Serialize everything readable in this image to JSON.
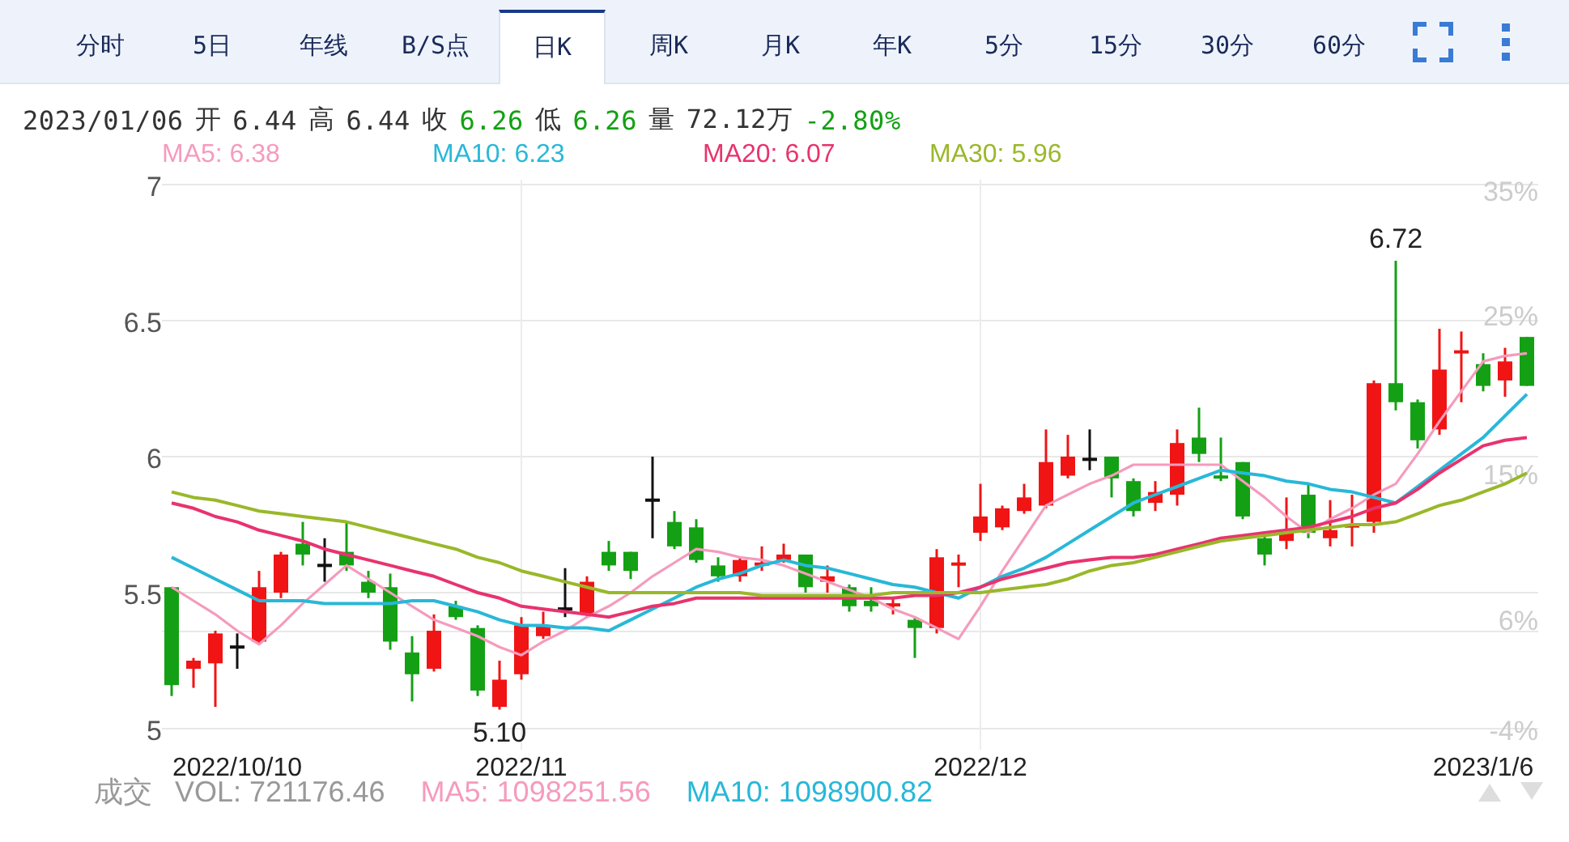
{
  "tabs": [
    {
      "label": "分时",
      "selected": false
    },
    {
      "label": "5日",
      "selected": false
    },
    {
      "label": "年线",
      "selected": false
    },
    {
      "label": "B/S点",
      "selected": false
    },
    {
      "label": "日K",
      "selected": true
    },
    {
      "label": "周K",
      "selected": false
    },
    {
      "label": "月K",
      "selected": false
    },
    {
      "label": "年K",
      "selected": false
    },
    {
      "label": "5分",
      "selected": false
    },
    {
      "label": "15分",
      "selected": false
    },
    {
      "label": "30分",
      "selected": false
    },
    {
      "label": "60分",
      "selected": false
    }
  ],
  "quote": {
    "date": "2023/01/06",
    "fields": [
      {
        "label": "开",
        "value": "6.44",
        "color": "#333333"
      },
      {
        "label": "高",
        "value": "6.44",
        "color": "#333333"
      },
      {
        "label": "收",
        "value": "6.26",
        "color": "#14a014"
      },
      {
        "label": "低",
        "value": "6.26",
        "color": "#14a014"
      },
      {
        "label": "量",
        "value": "72.12万",
        "color": "#333333"
      }
    ],
    "change": {
      "text": "-2.80%",
      "color": "#14a014"
    }
  },
  "chart": {
    "percent_labels": [
      "35%",
      "25%",
      "15%",
      "6%",
      "-4%"
    ],
    "chart_data": {
      "type": "candlestick",
      "ylim": [
        5,
        7
      ],
      "yticks": [
        5,
        5.5,
        6,
        6.5,
        7
      ],
      "grid": true,
      "categories": [
        null,
        null,
        null,
        "2022/10/10",
        null,
        null,
        null,
        null,
        null,
        null,
        null,
        null,
        null,
        null,
        null,
        null,
        "2022/11",
        null,
        null,
        null,
        null,
        null,
        null,
        null,
        null,
        null,
        null,
        null,
        null,
        null,
        null,
        null,
        null,
        null,
        null,
        null,
        null,
        "2022/12",
        null,
        null,
        null,
        null,
        null,
        null,
        null,
        null,
        null,
        null,
        null,
        null,
        null,
        null,
        null,
        null,
        null,
        null,
        null,
        null,
        null,
        null,
        "2023/1/6",
        null,
        null
      ],
      "ohlc": [
        [
          5.52,
          5.52,
          5.12,
          5.16
        ],
        [
          5.22,
          5.26,
          5.15,
          5.25
        ],
        [
          5.24,
          5.36,
          5.08,
          5.35
        ],
        [
          5.3,
          5.35,
          5.22,
          5.3
        ],
        [
          5.32,
          5.58,
          5.31,
          5.52
        ],
        [
          5.5,
          5.65,
          5.48,
          5.64
        ],
        [
          5.68,
          5.76,
          5.6,
          5.64
        ],
        [
          5.6,
          5.7,
          5.54,
          5.6
        ],
        [
          5.65,
          5.76,
          5.58,
          5.6
        ],
        [
          5.54,
          5.58,
          5.48,
          5.5
        ],
        [
          5.52,
          5.57,
          5.29,
          5.32
        ],
        [
          5.28,
          5.34,
          5.1,
          5.2
        ],
        [
          5.22,
          5.42,
          5.21,
          5.36
        ],
        [
          5.45,
          5.47,
          5.4,
          5.41
        ],
        [
          5.37,
          5.38,
          5.12,
          5.14
        ],
        [
          5.08,
          5.25,
          5.07,
          5.18
        ],
        [
          5.2,
          5.41,
          5.18,
          5.38
        ],
        [
          5.34,
          5.43,
          5.33,
          5.38
        ],
        [
          5.44,
          5.59,
          5.41,
          5.44
        ],
        [
          5.42,
          5.56,
          5.41,
          5.54
        ],
        [
          5.65,
          5.69,
          5.58,
          5.6
        ],
        [
          5.65,
          5.65,
          5.55,
          5.58
        ],
        [
          5.84,
          6.0,
          5.7,
          5.84
        ],
        [
          5.76,
          5.8,
          5.66,
          5.67
        ],
        [
          5.74,
          5.77,
          5.61,
          5.62
        ],
        [
          5.6,
          5.63,
          5.54,
          5.56
        ],
        [
          5.56,
          5.63,
          5.54,
          5.62
        ],
        [
          5.6,
          5.67,
          5.58,
          5.61
        ],
        [
          5.62,
          5.68,
          5.61,
          5.64
        ],
        [
          5.64,
          5.64,
          5.5,
          5.52
        ],
        [
          5.54,
          5.6,
          5.5,
          5.56
        ],
        [
          5.52,
          5.53,
          5.43,
          5.45
        ],
        [
          5.47,
          5.52,
          5.43,
          5.45
        ],
        [
          5.45,
          5.48,
          5.42,
          5.46
        ],
        [
          5.4,
          5.41,
          5.26,
          5.37
        ],
        [
          5.37,
          5.66,
          5.35,
          5.63
        ],
        [
          5.6,
          5.64,
          5.52,
          5.61
        ],
        [
          5.72,
          5.9,
          5.69,
          5.78
        ],
        [
          5.74,
          5.82,
          5.73,
          5.81
        ],
        [
          5.8,
          5.9,
          5.79,
          5.85
        ],
        [
          5.82,
          6.1,
          5.81,
          5.98
        ],
        [
          5.93,
          6.08,
          5.92,
          6.0
        ],
        [
          5.99,
          6.1,
          5.95,
          5.99
        ],
        [
          6.0,
          6.0,
          5.85,
          5.92
        ],
        [
          5.91,
          5.92,
          5.78,
          5.8
        ],
        [
          5.83,
          5.91,
          5.8,
          5.87
        ],
        [
          5.86,
          6.1,
          5.82,
          6.05
        ],
        [
          6.07,
          6.18,
          5.98,
          6.01
        ],
        [
          5.93,
          6.07,
          5.91,
          5.92
        ],
        [
          5.98,
          5.98,
          5.77,
          5.78
        ],
        [
          5.7,
          5.71,
          5.6,
          5.64
        ],
        [
          5.69,
          5.85,
          5.66,
          5.73
        ],
        [
          5.86,
          5.9,
          5.7,
          5.72
        ],
        [
          5.7,
          5.84,
          5.67,
          5.73
        ],
        [
          5.74,
          5.86,
          5.67,
          5.75
        ],
        [
          5.76,
          6.28,
          5.72,
          6.27
        ],
        [
          6.27,
          6.72,
          6.17,
          6.2
        ],
        [
          6.2,
          6.21,
          6.03,
          6.06
        ],
        [
          6.1,
          6.47,
          6.08,
          6.32
        ],
        [
          6.38,
          6.46,
          6.2,
          6.39
        ],
        [
          6.34,
          6.38,
          6.24,
          6.26
        ],
        [
          6.28,
          6.4,
          6.22,
          6.35
        ],
        [
          6.44,
          6.44,
          6.26,
          6.26
        ]
      ],
      "series": [
        {
          "name": "MA5: 6.38",
          "type": "line",
          "color": "#f59bbd",
          "values": [
            5.52,
            5.47,
            5.42,
            5.36,
            5.31,
            5.38,
            5.46,
            5.53,
            5.6,
            5.55,
            5.5,
            5.45,
            5.4,
            5.37,
            5.34,
            5.3,
            5.27,
            5.32,
            5.36,
            5.41,
            5.45,
            5.5,
            5.56,
            5.61,
            5.66,
            5.65,
            5.63,
            5.62,
            5.6,
            5.57,
            5.54,
            5.51,
            5.48,
            5.44,
            5.41,
            5.37,
            5.33,
            5.45,
            5.58,
            5.7,
            5.82,
            5.86,
            5.9,
            5.93,
            5.97,
            5.97,
            5.97,
            5.97,
            5.97,
            5.91,
            5.85,
            5.78,
            5.72,
            5.77,
            5.81,
            5.86,
            5.9,
            6.01,
            6.13,
            6.24,
            6.35,
            6.37,
            6.38
          ]
        },
        {
          "name": "MA10: 6.23",
          "type": "line",
          "color": "#28b8d8",
          "values": [
            5.63,
            5.59,
            5.55,
            5.51,
            5.47,
            5.47,
            5.47,
            5.46,
            5.46,
            5.46,
            5.46,
            5.47,
            5.47,
            5.45,
            5.43,
            5.4,
            5.38,
            5.38,
            5.37,
            5.37,
            5.36,
            5.4,
            5.44,
            5.48,
            5.52,
            5.55,
            5.57,
            5.6,
            5.62,
            5.6,
            5.59,
            5.57,
            5.55,
            5.53,
            5.52,
            5.5,
            5.48,
            5.52,
            5.56,
            5.59,
            5.63,
            5.68,
            5.73,
            5.78,
            5.83,
            5.86,
            5.89,
            5.92,
            5.95,
            5.94,
            5.93,
            5.91,
            5.9,
            5.88,
            5.87,
            5.85,
            5.83,
            5.89,
            5.95,
            6.01,
            6.07,
            6.15,
            6.23
          ]
        },
        {
          "name": "MA20: 6.07",
          "type": "line",
          "color": "#e8336e",
          "values": [
            5.83,
            5.81,
            5.78,
            5.76,
            5.73,
            5.71,
            5.69,
            5.66,
            5.64,
            5.62,
            5.6,
            5.58,
            5.56,
            5.53,
            5.5,
            5.48,
            5.45,
            5.44,
            5.43,
            5.42,
            5.41,
            5.43,
            5.45,
            5.46,
            5.48,
            5.48,
            5.48,
            5.48,
            5.48,
            5.48,
            5.48,
            5.48,
            5.48,
            5.48,
            5.49,
            5.49,
            5.5,
            5.52,
            5.55,
            5.57,
            5.59,
            5.61,
            5.62,
            5.63,
            5.63,
            5.64,
            5.66,
            5.68,
            5.7,
            5.71,
            5.72,
            5.73,
            5.74,
            5.76,
            5.78,
            5.81,
            5.83,
            5.88,
            5.94,
            5.99,
            6.04,
            6.06,
            6.07
          ]
        },
        {
          "name": "MA30: 5.96",
          "type": "line",
          "color": "#99b82a",
          "values": [
            5.87,
            5.85,
            5.84,
            5.82,
            5.8,
            5.79,
            5.78,
            5.77,
            5.76,
            5.74,
            5.72,
            5.7,
            5.68,
            5.66,
            5.63,
            5.61,
            5.58,
            5.56,
            5.54,
            5.52,
            5.5,
            5.5,
            5.5,
            5.5,
            5.5,
            5.5,
            5.5,
            5.49,
            5.49,
            5.49,
            5.49,
            5.49,
            5.49,
            5.5,
            5.5,
            5.5,
            5.5,
            5.5,
            5.51,
            5.52,
            5.53,
            5.55,
            5.58,
            5.6,
            5.61,
            5.63,
            5.65,
            5.67,
            5.69,
            5.7,
            5.71,
            5.72,
            5.73,
            5.74,
            5.75,
            5.75,
            5.76,
            5.79,
            5.82,
            5.84,
            5.87,
            5.9,
            5.94
          ]
        }
      ],
      "annotations": [
        "6.72",
        "5.10"
      ]
    }
  },
  "volume_legend": {
    "title": "成交",
    "items": [
      {
        "text": "VOL: 721176.46",
        "color": "#999999"
      },
      {
        "text": "MA5: 1098251.56",
        "color": "#f59bbd"
      },
      {
        "text": "MA10: 1098900.82",
        "color": "#28b8d8"
      }
    ]
  }
}
